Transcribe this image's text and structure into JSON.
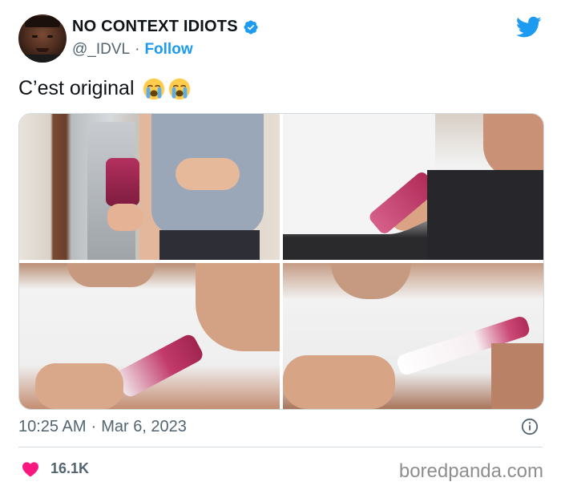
{
  "header": {
    "display_name": "NO CONTEXT IDIOTS",
    "handle": "@_IDVL",
    "separator": "·",
    "follow_label": "Follow"
  },
  "tweet": {
    "text": "C’est original",
    "emojis": [
      "loudly-crying-face",
      "loudly-crying-face"
    ]
  },
  "media": {
    "photos": [
      {
        "id": "photo-1",
        "subject": "woman holding popsicle"
      },
      {
        "id": "photo-2",
        "subject": "man licking popsicle"
      },
      {
        "id": "photo-3",
        "subject": "popsicle close-up"
      },
      {
        "id": "photo-4",
        "subject": "popsicle melted white"
      }
    ]
  },
  "footer": {
    "time": "10:25 AM",
    "separator": "·",
    "date": "Mar 6, 2023",
    "likes": "16.1K"
  },
  "watermark": "boredpanda.com",
  "colors": {
    "accent": "#1d9bf0",
    "heart": "#f91880",
    "muted": "#536471"
  }
}
